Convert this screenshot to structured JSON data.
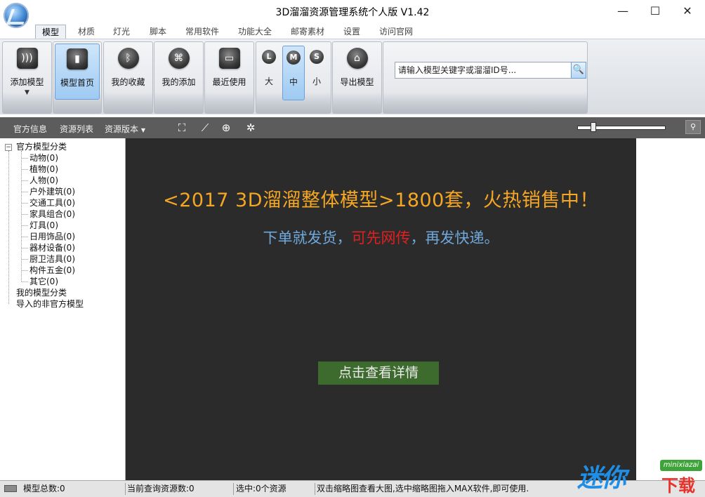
{
  "window": {
    "title": "3D溜溜资源管理系统个人版 V1.42",
    "controls": {
      "minimize": "—",
      "maximize": "☐",
      "close": "✕"
    }
  },
  "tabs": [
    {
      "label": "模型",
      "active": true
    },
    {
      "label": "材质"
    },
    {
      "label": "灯光"
    },
    {
      "label": "脚本"
    },
    {
      "label": "常用软件"
    },
    {
      "label": "功能大全"
    },
    {
      "label": "邮寄素材"
    },
    {
      "label": "设置"
    },
    {
      "label": "访问官网"
    }
  ],
  "ribbon": {
    "add_model": {
      "label": "添加模型",
      "icon": "rss-icon",
      "arrow": "▼"
    },
    "model_home": {
      "label": "模型首页",
      "icon": "film-icon",
      "pressed": true
    },
    "my_favorites": {
      "label": "我的收藏",
      "icon": "bluetooth-icon"
    },
    "my_added": {
      "label": "我的添加",
      "icon": "tag-icon"
    },
    "recent_used": {
      "label": "最近使用",
      "icon": "drive-icon"
    },
    "sizes": [
      {
        "letter": "L",
        "label": "大"
      },
      {
        "letter": "M",
        "label": "中",
        "pressed": true
      },
      {
        "letter": "S",
        "label": "小"
      }
    ],
    "export_model": {
      "label": "导出模型",
      "icon": "export-icon"
    },
    "search": {
      "value": "请输入模型关键字或溜溜ID号..."
    }
  },
  "toolbar": {
    "official_info": "官方信息",
    "resource_list": "资源列表",
    "resource_version": "资源版本",
    "dropdown_arrow": "▼",
    "slider_value": 0.15
  },
  "tree": {
    "root": "官方模型分类",
    "expander": "−",
    "children": [
      "动物(0)",
      "植物(0)",
      "人物(0)",
      "户外建筑(0)",
      "交通工具(0)",
      "家具组合(0)",
      "灯具(0)",
      "日用饰品(0)",
      "器材设备(0)",
      "厨卫洁具(0)",
      "构件五金(0)",
      "其它(0)"
    ],
    "my_categories": "我的模型分类",
    "imported": "导入的非官方模型"
  },
  "content": {
    "headline": "<2017 3D溜溜整体模型>1800套，火热销售中！",
    "sub_part1": "下单就发货，",
    "sub_red": "可先网传",
    "sub_part2": "，再发快递。",
    "detail_button": "点击查看详情",
    "colors": {
      "headline": "#f5a623",
      "sub": "#6fa8dc",
      "red": "#e02020",
      "button": "#3d6b2e"
    }
  },
  "statusbar": {
    "total_models": "模型总数:0",
    "current_count": "当前查询资源数:0",
    "selected": "选中:0个资源",
    "hint": "双击缩略图查看大图,选中缩略图拖入MAX软件,即可使用."
  },
  "watermark": {
    "big": "迷你",
    "tag": "minixiazai",
    "red": "下载"
  }
}
